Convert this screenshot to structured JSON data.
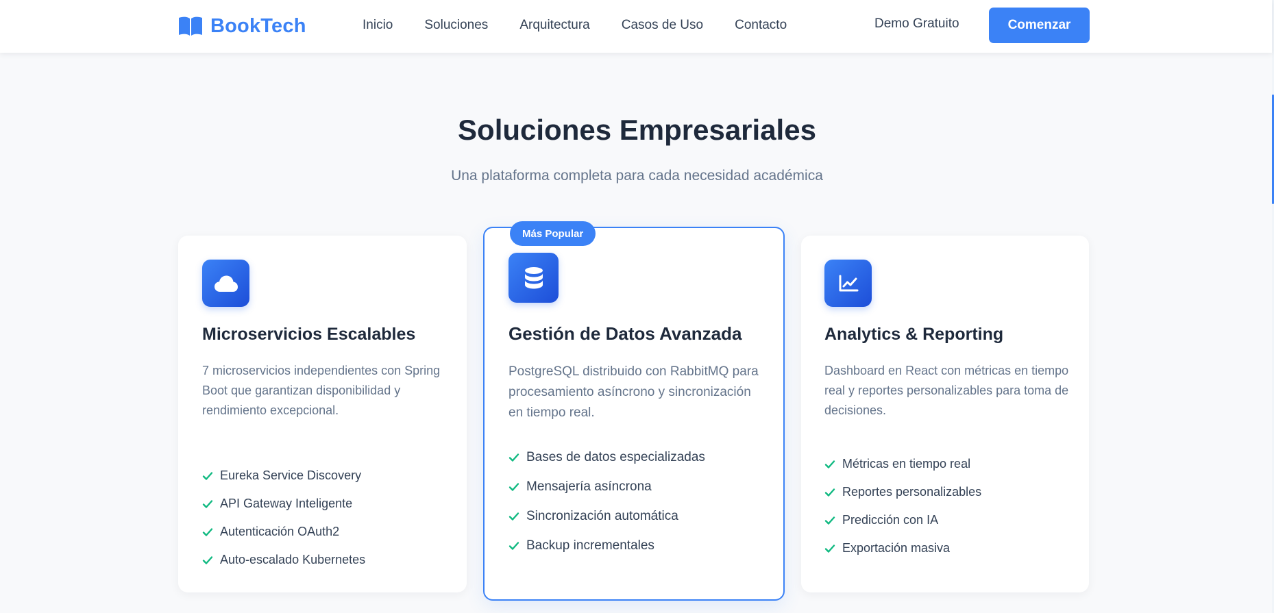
{
  "nav": {
    "brand": "BookTech",
    "links": [
      "Inicio",
      "Soluciones",
      "Arquitectura",
      "Casos de Uso",
      "Contacto"
    ],
    "demo": "Demo Gratuito",
    "cta": "Comenzar"
  },
  "section": {
    "title": "Soluciones Empresariales",
    "subtitle": "Una plataforma completa para cada necesidad académica"
  },
  "cards": [
    {
      "icon": "cloud-icon",
      "title": "Microservicios Escalables",
      "description": "7 microservicios independientes con Spring Boot que garantizan disponibilidad y rendimiento excepcional.",
      "features": [
        "Eureka Service Discovery",
        "API Gateway Inteligente",
        "Autenticación OAuth2",
        "Auto-escalado Kubernetes"
      ]
    },
    {
      "badge": "Más Popular",
      "icon": "database-icon",
      "title": "Gestión de Datos Avanzada",
      "description": "PostgreSQL distribuido con RabbitMQ para procesamiento asíncrono y sincronización en tiempo real.",
      "features": [
        "Bases de datos especializadas",
        "Mensajería asíncrona",
        "Sincronización automática",
        "Backup incrementales"
      ]
    },
    {
      "icon": "chart-line-icon",
      "title": "Analytics & Reporting",
      "description": "Dashboard en React con métricas en tiempo real y reportes personalizables para toma de decisiones.",
      "features": [
        "Métricas en tiempo real",
        "Reportes personalizables",
        "Predicción con IA",
        "Exportación masiva"
      ]
    }
  ],
  "colors": {
    "accent": "#3b82f6",
    "check": "#10b981",
    "background": "#f8f9fb",
    "heading": "#1e293b",
    "muted": "#64748b"
  }
}
